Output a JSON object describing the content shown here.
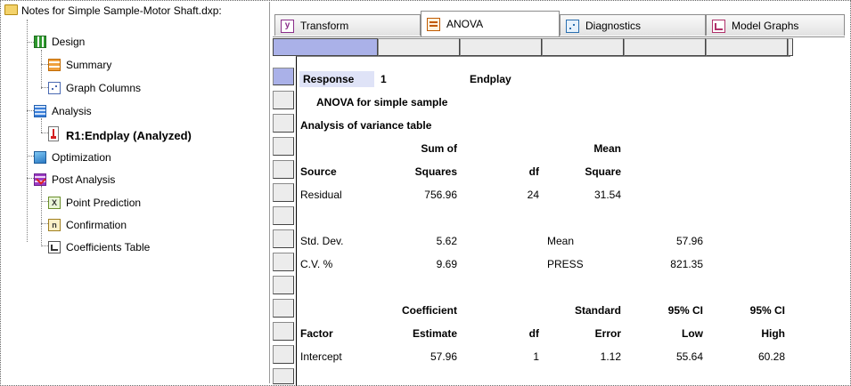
{
  "tree": {
    "root": {
      "label": "Notes for Simple Sample-Motor Shaft.dxp:",
      "icon": "folder-icon"
    },
    "items": [
      {
        "label": "Design",
        "icon": "design-icon"
      },
      {
        "label": "Summary",
        "icon": "summary-icon"
      },
      {
        "label": "Graph Columns",
        "icon": "graph-columns-icon"
      },
      {
        "label": "Analysis",
        "icon": "analysis-icon"
      },
      {
        "label": "R1:Endplay (Analyzed)",
        "icon": "response-icon"
      },
      {
        "label": "Optimization",
        "icon": "optimization-icon"
      },
      {
        "label": "Post Analysis",
        "icon": "post-analysis-icon"
      },
      {
        "label": "Point Prediction",
        "icon": "point-prediction-icon"
      },
      {
        "label": "Confirmation",
        "icon": "confirmation-icon"
      },
      {
        "label": "Coefficients Table",
        "icon": "coefficients-table-icon"
      }
    ]
  },
  "tabs": [
    {
      "label": "Transform",
      "icon": "transform-icon"
    },
    {
      "label": "ANOVA",
      "icon": "anova-icon"
    },
    {
      "label": "Diagnostics",
      "icon": "diagnostics-icon"
    },
    {
      "label": "Model Graphs",
      "icon": "model-graphs-icon"
    }
  ],
  "grid": {
    "rows": [
      [
        "Response",
        "1",
        "",
        "Endplay",
        "",
        "",
        ""
      ],
      [
        "ANOVA for simple sample",
        "",
        "",
        "",
        "",
        "",
        ""
      ],
      [
        "Analysis of variance table",
        "",
        "",
        "",
        "",
        "",
        ""
      ],
      [
        "",
        "Sum of",
        "",
        "Mean",
        "",
        "",
        ""
      ],
      [
        "Source",
        "Squares",
        "df",
        "Square",
        "",
        "",
        ""
      ],
      [
        "Residual",
        "756.96",
        "24",
        "31.54",
        "",
        "",
        ""
      ],
      [
        "",
        "",
        "",
        "",
        "",
        "",
        ""
      ],
      [
        "Std. Dev.",
        "5.62",
        "",
        "Mean",
        "57.96",
        "",
        ""
      ],
      [
        "C.V. %",
        "9.69",
        "",
        "PRESS",
        "821.35",
        "",
        ""
      ],
      [
        "",
        "",
        "",
        "",
        "",
        "",
        ""
      ],
      [
        "",
        "Coefficient",
        "",
        "Standard",
        "95% CI",
        "95% CI",
        ""
      ],
      [
        "Factor",
        "Estimate",
        "df",
        "Error",
        "Low",
        "High",
        ""
      ],
      [
        "Intercept",
        "57.96",
        "1",
        "1.12",
        "55.64",
        "60.28",
        ""
      ]
    ]
  },
  "colors": {
    "header_blue": "#aab1e8",
    "response_highlight": "#dfe3f7"
  }
}
